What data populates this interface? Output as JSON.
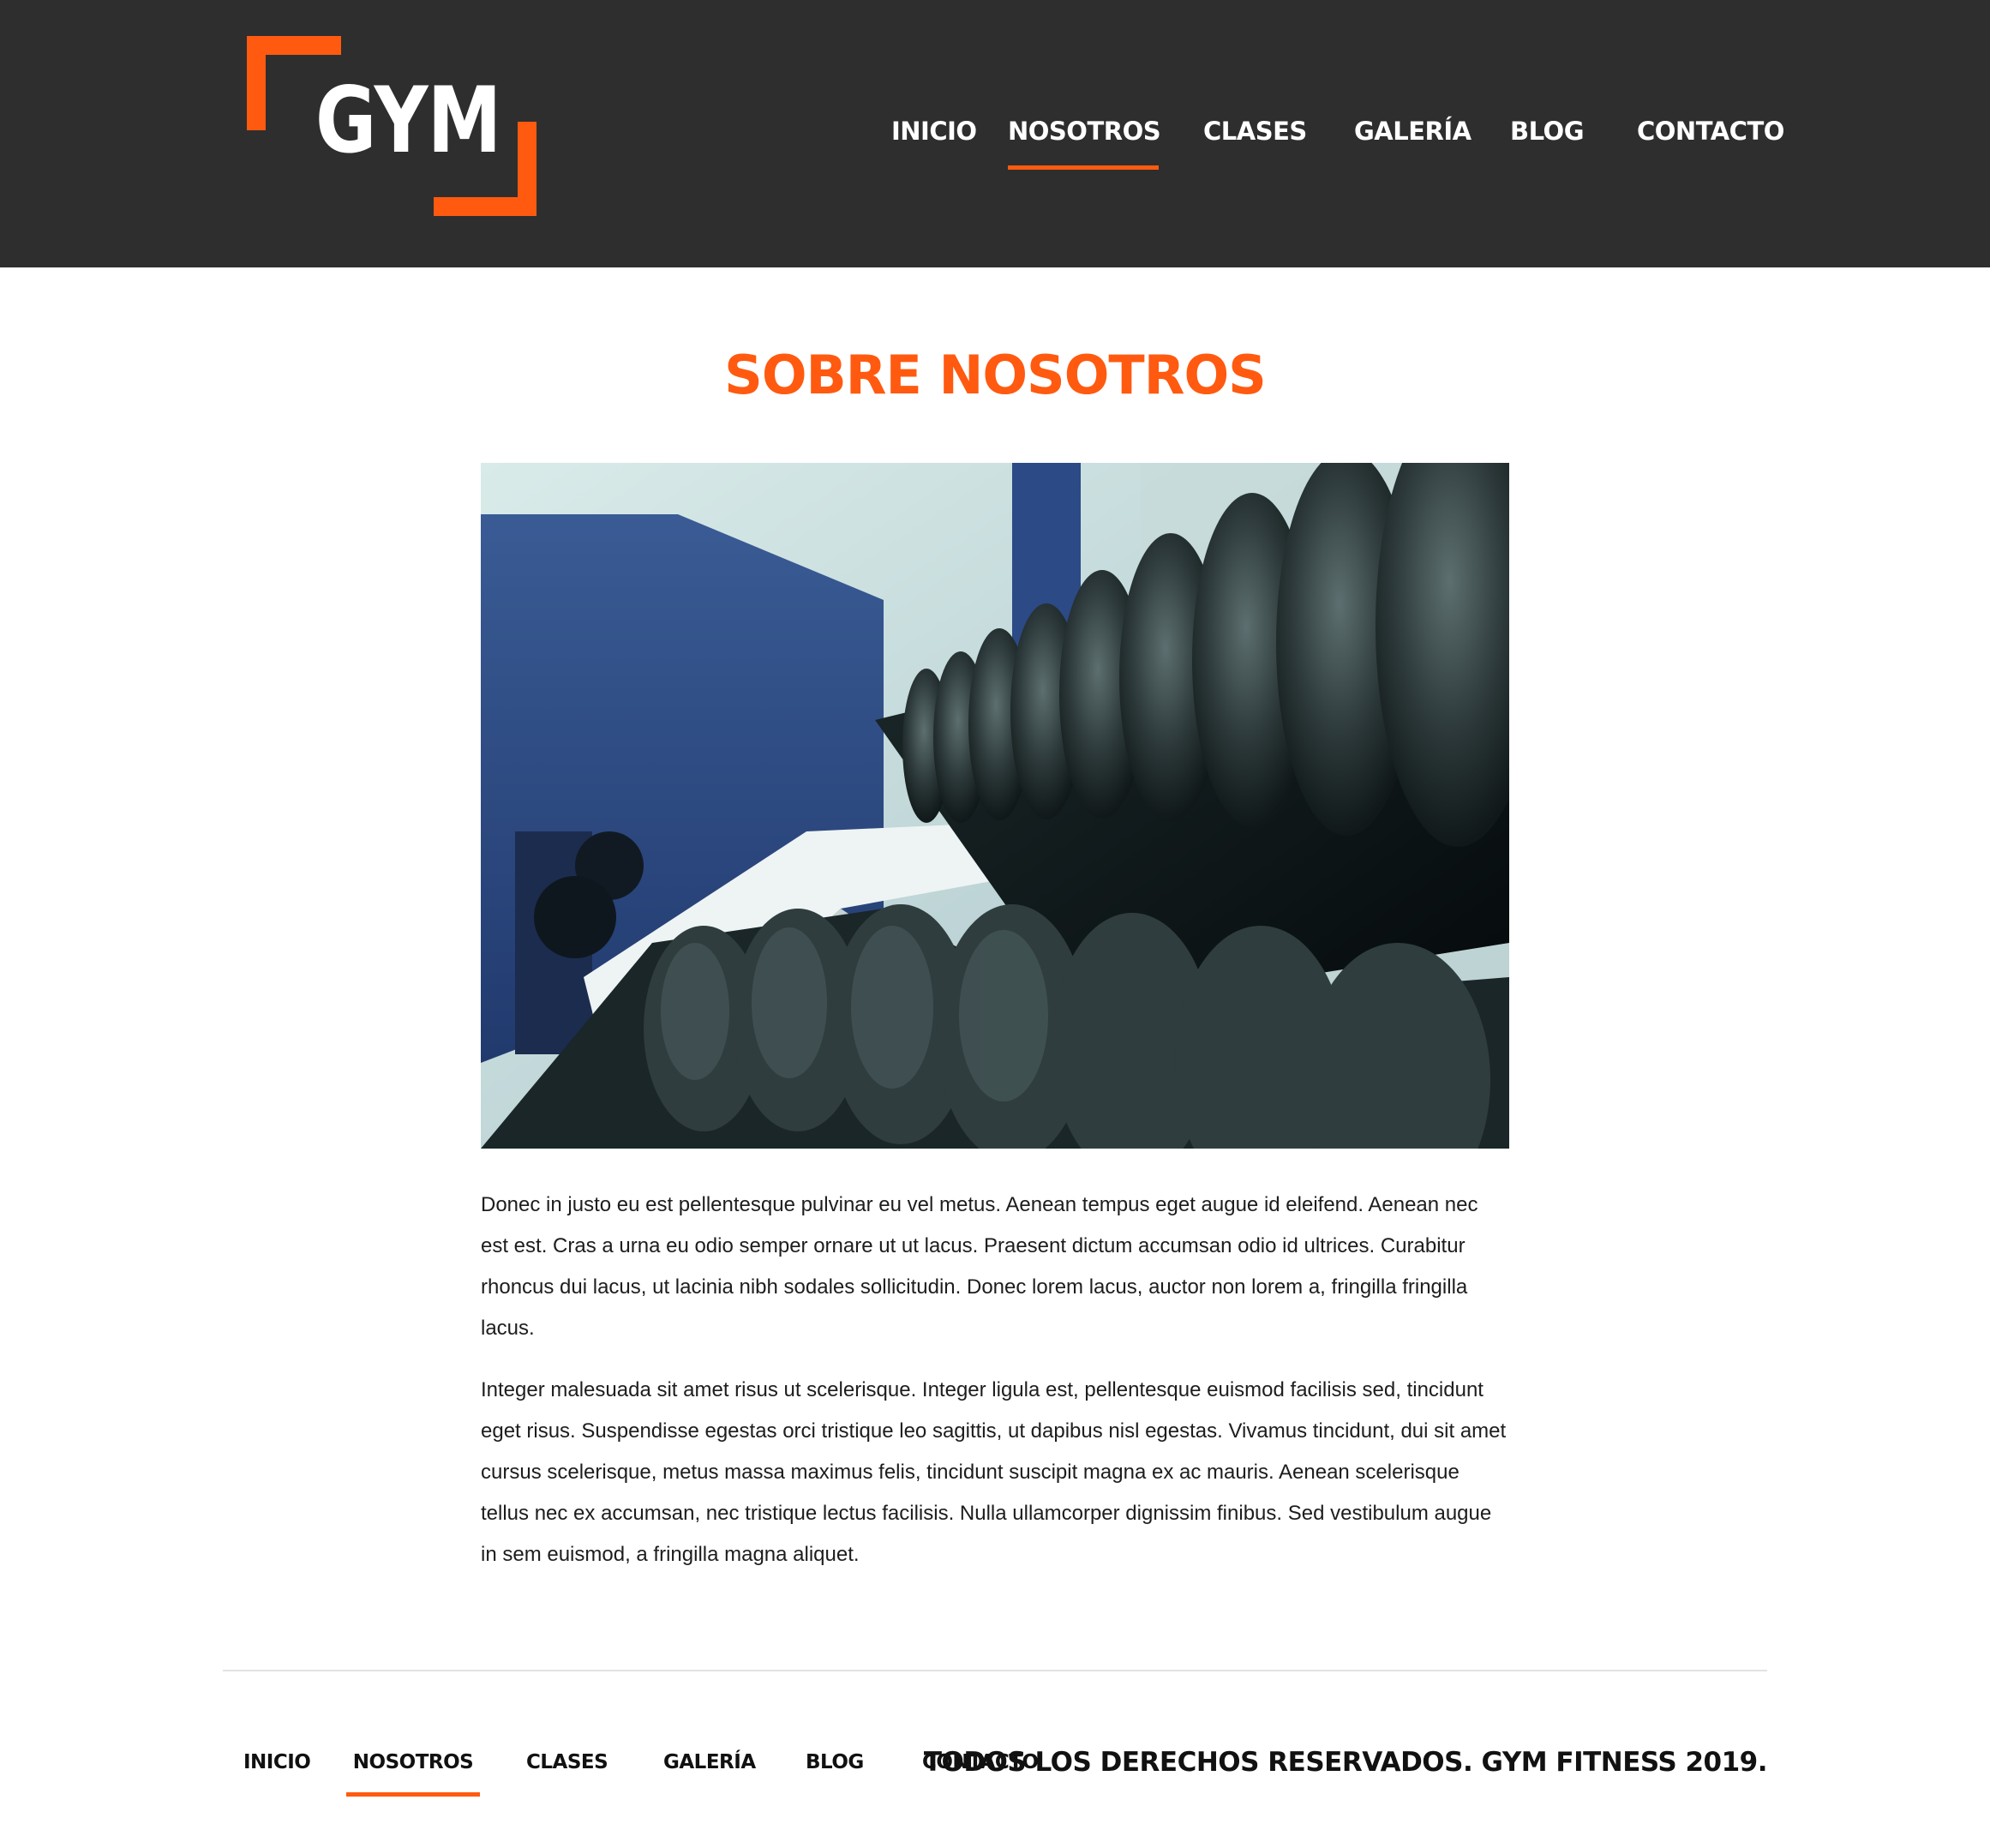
{
  "header": {
    "logo_text": "GYM",
    "nav": [
      {
        "label": "INICIO",
        "active": false
      },
      {
        "label": "NOSOTROS",
        "active": true
      },
      {
        "label": "CLASES",
        "active": false
      },
      {
        "label": "GALERÍA",
        "active": false
      },
      {
        "label": "BLOG",
        "active": false
      },
      {
        "label": "CONTACTO",
        "active": false
      }
    ]
  },
  "main": {
    "title": "SOBRE NOSOTROS",
    "image_subject": "gym dumbbell rack",
    "paragraphs": [
      "Donec in justo eu est pellentesque pulvinar eu vel metus. Aenean tempus eget augue id eleifend. Aenean nec est est. Cras a urna eu odio semper ornare ut ut lacus. Praesent dictum accumsan odio id ultrices. Curabitur rhoncus dui lacus, ut lacinia nibh sodales sollicitudin. Donec lorem lacus, auctor non lorem a, fringilla fringilla lacus.",
      "Integer malesuada sit amet risus ut scelerisque. Integer ligula est, pellentesque euismod facilisis sed, tincidunt eget risus. Suspendisse egestas orci tristique leo sagittis, ut dapibus nisl egestas. Vivamus tincidunt, dui sit amet cursus scelerisque, metus massa maximus felis, tincidunt suscipit magna ex ac mauris. Aenean scelerisque tellus nec ex accumsan, nec tristique lectus facilisis. Nulla ullamcorper dignissim finibus. Sed vestibulum augue in sem euismod, a fringilla magna aliquet."
    ]
  },
  "footer": {
    "nav": [
      {
        "label": "INICIO",
        "active": false
      },
      {
        "label": "NOSOTROS",
        "active": true
      },
      {
        "label": "CLASES",
        "active": false
      },
      {
        "label": "GALERÍA",
        "active": false
      },
      {
        "label": "BLOG",
        "active": false
      },
      {
        "label": "CONTACTO",
        "active": false
      }
    ],
    "copyright": "TODOS LOS DERECHOS RESERVADOS. GYM FITNESS 2019."
  },
  "colors": {
    "accent": "#ff5a10",
    "header_bg": "#2e2e2e",
    "text": "#1d1d1d"
  }
}
